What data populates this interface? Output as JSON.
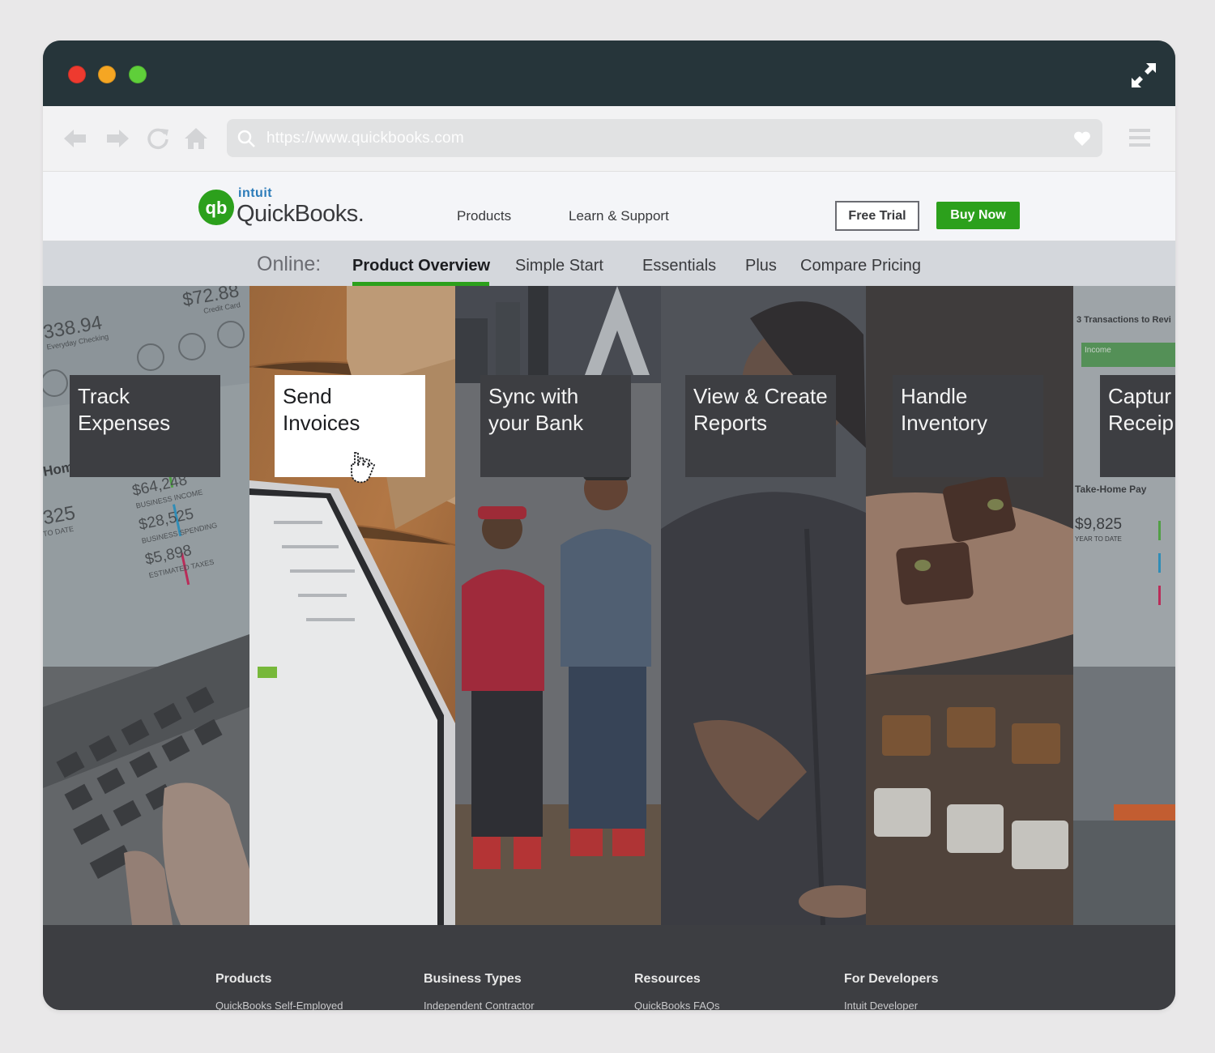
{
  "browser": {
    "url": "https://www.quickbooks.com"
  },
  "header": {
    "logo_parent": "intuit",
    "logo_brand": "QuickBooks.",
    "nav": [
      "Products",
      "Learn & Support"
    ],
    "free_trial": "Free Trial",
    "buy_now": "Buy Now"
  },
  "subnav": {
    "label": "Online:",
    "items": [
      "Product Overview",
      "Simple Start",
      "Essentials",
      "Plus",
      "Compare Pricing"
    ],
    "active": "Product Overview"
  },
  "hero": {
    "panels": [
      {
        "line1": "Track",
        "line2": "Expenses"
      },
      {
        "line1": "Send",
        "line2": "Invoices"
      },
      {
        "line1": "Sync with",
        "line2": "your Bank"
      },
      {
        "line1": "View & Create",
        "line2": "Reports"
      },
      {
        "line1": "Handle",
        "line2": "Inventory"
      },
      {
        "line1": "Captur",
        "line2": "Receip"
      }
    ],
    "screen_text": {
      "amount1": "338.94",
      "acct1": "Everyday Checking",
      "amount2": "$72.88",
      "acct2": "Credit Card",
      "amount3": "$64,248",
      "label3": "BUSINESS INCOME",
      "amount4": "$28,525",
      "label4": "BUSINESS SPENDING",
      "amount5": "$5,898",
      "label5": "ESTIMATED TAXES",
      "left1": "Home",
      "left2": "325",
      "left3": "TO DATE",
      "r1": "3 Transactions to Revi",
      "r2": "Income",
      "r3": "Take-Home Pay",
      "r4": "$9,825",
      "r5": "YEAR TO DATE"
    }
  },
  "footer": {
    "columns": [
      {
        "title": "Products",
        "link": "QuickBooks Self-Employed"
      },
      {
        "title": "Business Types",
        "link": "Independent Contractor"
      },
      {
        "title": "Resources",
        "link": "QuickBooks FAQs"
      },
      {
        "title": "For Developers",
        "link": "Intuit Developer"
      }
    ]
  },
  "colors": {
    "brand_green": "#2ca01c",
    "titlebar": "#26353a",
    "card_dark": "#3d3e42"
  }
}
